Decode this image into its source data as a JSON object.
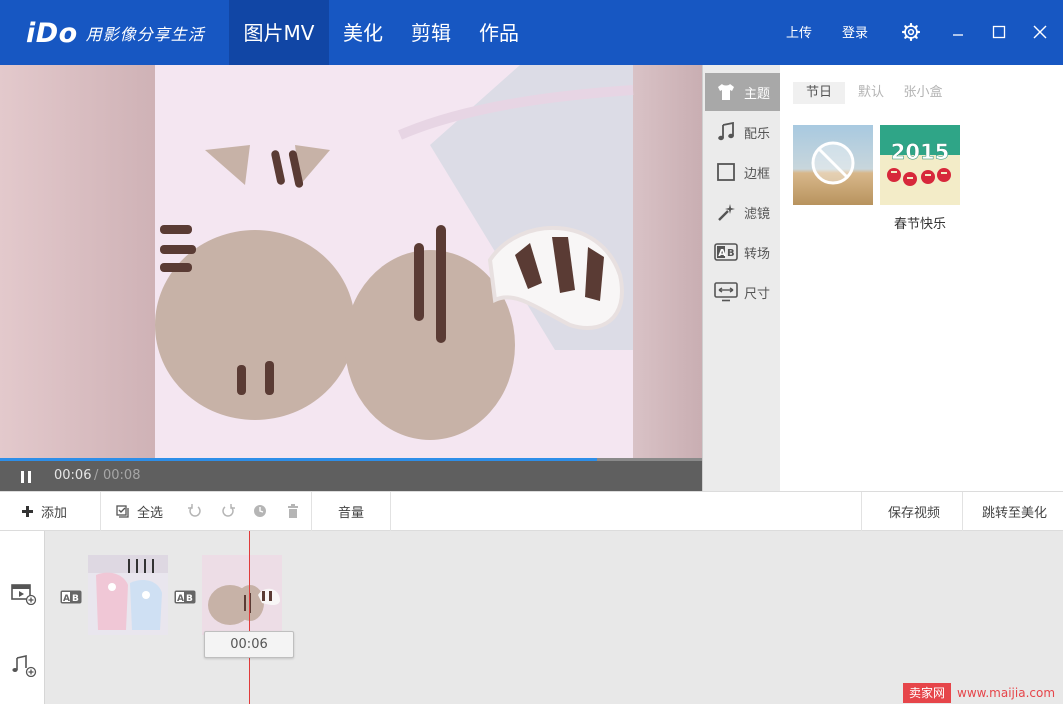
{
  "app": {
    "logo": "iDo",
    "slogan": "用影像分享生活"
  },
  "nav": {
    "tabs": [
      {
        "label": "图片MV",
        "active": true
      },
      {
        "label": "美化"
      },
      {
        "label": "剪辑"
      },
      {
        "label": "作品"
      }
    ],
    "upload_label": "上传",
    "login_label": "登录"
  },
  "player": {
    "current_time": "00:06",
    "separator": "/",
    "total_time": "00:08",
    "progress": 0.85
  },
  "side_tabs": [
    {
      "label": "主题",
      "icon": "tshirt-icon",
      "active": true
    },
    {
      "label": "配乐",
      "icon": "music-note-icon"
    },
    {
      "label": "边框",
      "icon": "frame-icon"
    },
    {
      "label": "滤镜",
      "icon": "magic-wand-icon"
    },
    {
      "label": "转场",
      "icon": "transition-ab-icon"
    },
    {
      "label": "尺寸",
      "icon": "resize-screen-icon"
    }
  ],
  "theme_panel": {
    "sub_tabs": [
      {
        "label": "节日",
        "active": true
      },
      {
        "label": "默认"
      },
      {
        "label": "张小盒"
      }
    ],
    "theme_thumb_text": "2015",
    "theme_caption": "春节快乐"
  },
  "toolbar": {
    "add_label": "添加",
    "select_all_label": "全选",
    "volume_label": "音量",
    "save_video_label": "保存视频",
    "go_beautify_label": "跳转至美化"
  },
  "timeline": {
    "playhead_time": "00:06"
  },
  "watermark": {
    "brand": "卖家网",
    "url": "www.maijia.com"
  },
  "colors": {
    "top_bar": "#1757c2",
    "active_nav": "#1146a5",
    "progress": "#2d8ee8",
    "playhead": "#e03b3b"
  }
}
